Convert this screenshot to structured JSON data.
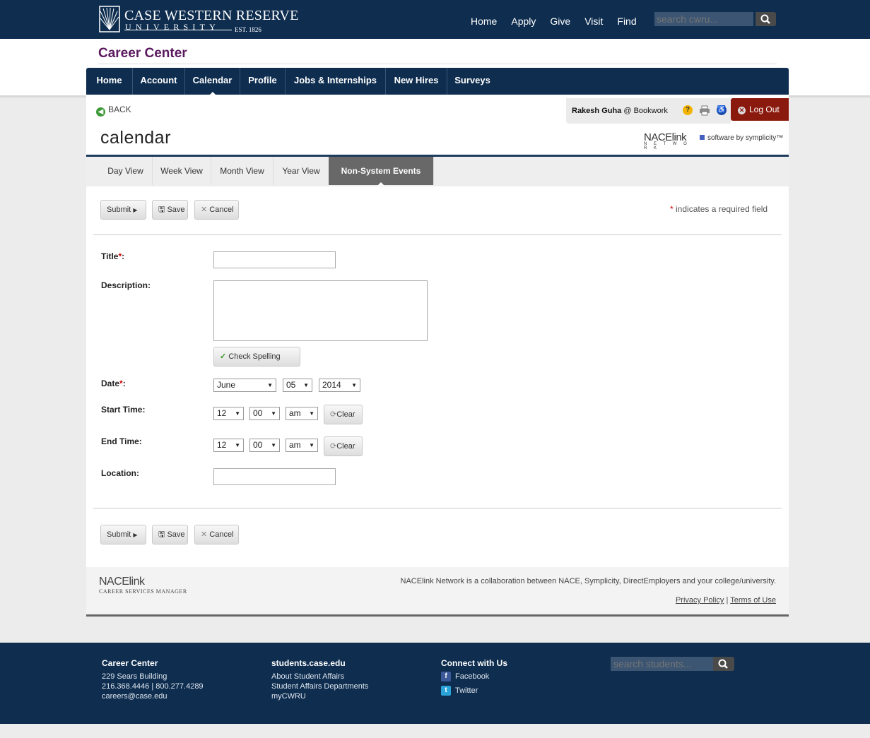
{
  "header": {
    "logo_line1": "CASE WESTERN RESERVE",
    "logo_line2": "UNIVERSITY",
    "logo_est": "EST. 1826",
    "nav": [
      "Home",
      "Apply",
      "Give",
      "Visit",
      "Find"
    ],
    "search_placeholder": "search cwru..."
  },
  "site_title": "Career Center",
  "main_nav": [
    "Home",
    "Account",
    "Calendar",
    "Profile",
    "Jobs & Internships",
    "New Hires",
    "Surveys"
  ],
  "main_nav_active": "Calendar",
  "back_label": "BACK",
  "user": {
    "name": "Rakesh Guha",
    "at": "@ Bookwork",
    "logout": "Log Out"
  },
  "page_title": "calendar",
  "brand": {
    "nace_top": "NACElink",
    "nace_bottom": "N E T W O R K",
    "symplicity": "software by symplicity™"
  },
  "sub_tabs": [
    "Day View",
    "Week View",
    "Month View",
    "Year View",
    "Non-System Events"
  ],
  "sub_tab_active": "Non-System Events",
  "buttons": {
    "submit": "Submit",
    "save": "Save",
    "cancel": "Cancel",
    "check_spelling": "Check Spelling",
    "clear": "Clear"
  },
  "required_note": {
    "star": "*",
    "text": "indicates a required field"
  },
  "form": {
    "title_label": "Title",
    "description_label": "Description:",
    "date_label": "Date",
    "start_label": "Start Time:",
    "end_label": "End Time:",
    "location_label": "Location:",
    "date": {
      "month": "June",
      "day": "05",
      "year": "2014"
    },
    "start": {
      "hour": "12",
      "minute": "00",
      "ampm": "am"
    },
    "end": {
      "hour": "12",
      "minute": "00",
      "ampm": "am"
    },
    "title_value": "",
    "description_value": "",
    "location_value": ""
  },
  "footer": {
    "nace_top": "NACElink",
    "nace_bottom": "CAREER SERVICES MANAGER",
    "note": "NACElink Network is a collaboration between NACE, Symplicity, DirectEmployers and your college/university.",
    "privacy": "Privacy Policy",
    "sep": "|",
    "terms": "Terms of Use"
  },
  "bottom": {
    "col1": {
      "heading": "Career Center",
      "lines": [
        "229 Sears Building",
        "216.368.4446 | 800.277.4289",
        "careers@case.edu"
      ]
    },
    "col2": {
      "heading": "students.case.edu",
      "lines": [
        "About Student Affairs",
        "Student Affairs Departments",
        "myCWRU"
      ]
    },
    "col3": {
      "heading": "Connect with Us",
      "facebook": "Facebook",
      "twitter": "Twitter"
    },
    "search_placeholder": "search students..."
  },
  "colors": {
    "navy": "#0e2d4f",
    "purple": "#5a1a5e",
    "logout_red": "#8b1a0e",
    "active_tab": "#686868"
  }
}
